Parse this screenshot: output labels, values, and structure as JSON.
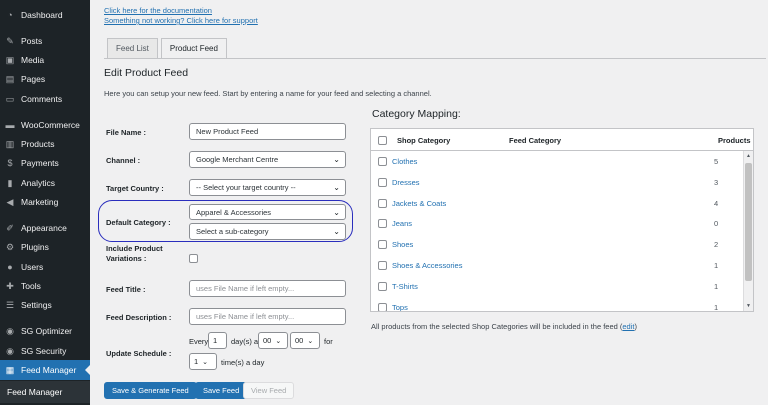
{
  "sidebar": {
    "items": [
      {
        "label": "Dashboard",
        "icon": "dashboard-icon",
        "glyph": "◔"
      },
      {
        "label": "Posts",
        "icon": "pin-icon",
        "glyph": "✎"
      },
      {
        "label": "Media",
        "icon": "media-icon",
        "glyph": "▣"
      },
      {
        "label": "Pages",
        "icon": "pages-icon",
        "glyph": "▤"
      },
      {
        "label": "Comments",
        "icon": "comments-icon",
        "glyph": "▭"
      },
      {
        "label": "WooCommerce",
        "icon": "woocommerce-icon",
        "glyph": "▬"
      },
      {
        "label": "Products",
        "icon": "products-icon",
        "glyph": "▥"
      },
      {
        "label": "Payments",
        "icon": "payments-icon",
        "glyph": "$"
      },
      {
        "label": "Analytics",
        "icon": "analytics-icon",
        "glyph": "▮"
      },
      {
        "label": "Marketing",
        "icon": "megaphone-icon",
        "glyph": "◀"
      },
      {
        "label": "Appearance",
        "icon": "brush-icon",
        "glyph": "✐"
      },
      {
        "label": "Plugins",
        "icon": "plugin-icon",
        "glyph": "⚙"
      },
      {
        "label": "Users",
        "icon": "user-icon",
        "glyph": "●"
      },
      {
        "label": "Tools",
        "icon": "wrench-icon",
        "glyph": "✚"
      },
      {
        "label": "Settings",
        "icon": "settings-icon",
        "glyph": "☰"
      },
      {
        "label": "SG Optimizer",
        "icon": "sg-optimizer-icon",
        "glyph": "◉"
      },
      {
        "label": "SG Security",
        "icon": "sg-security-icon",
        "glyph": "◉"
      },
      {
        "label": "Feed Manager",
        "icon": "feed-manager-icon",
        "glyph": "▦"
      }
    ],
    "submenu_label": "Feed Manager"
  },
  "links": {
    "docs": "Click here for the documentation",
    "support": "Something not working? Click here for support"
  },
  "tabs": [
    "Feed List",
    "Product Feed"
  ],
  "page_title": "Edit Product Feed",
  "intro": "Here you can setup your new feed. Start by entering a name for your feed and selecting a channel.",
  "form": {
    "file_name_label": "File Name :",
    "file_name_value": "New Product Feed",
    "channel_label": "Channel :",
    "channel_value": "Google Merchant Centre",
    "target_country_label": "Target Country :",
    "target_country_value": "-- Select your target country --",
    "default_category_label": "Default Category :",
    "default_category_value": "Apparel & Accessories",
    "sub_category_value": "Select a sub-category",
    "include_variations_label": "Include Product Variations :",
    "feed_title_label": "Feed Title :",
    "feed_title_placeholder": "uses File Name if left empty...",
    "feed_description_label": "Feed Description :",
    "feed_description_placeholder": "uses File Name if left empty...",
    "update_schedule_label": "Update Schedule :",
    "schedule_every": "Every",
    "schedule_days_value": "1",
    "schedule_days_suffix": "day(s) at",
    "schedule_hour": "00",
    "schedule_minute": "00",
    "schedule_for": "for",
    "schedule_times_value": "1",
    "schedule_times_suffix": "time(s) a day"
  },
  "buttons": {
    "save_generate": "Save & Generate Feed",
    "save": "Save Feed",
    "view": "View Feed"
  },
  "category_mapping": {
    "title": "Category Mapping:",
    "headers": [
      "Shop Category",
      "Feed Category",
      "Products"
    ],
    "rows": [
      {
        "name": "Clothes",
        "count": "5"
      },
      {
        "name": "Dresses",
        "count": "3"
      },
      {
        "name": "Jackets & Coats",
        "count": "4"
      },
      {
        "name": "Jeans",
        "count": "0"
      },
      {
        "name": "Shoes",
        "count": "2"
      },
      {
        "name": "Shoes & Accessories",
        "count": "1"
      },
      {
        "name": "T-Shirts",
        "count": "1"
      },
      {
        "name": "Tops",
        "count": "1"
      }
    ],
    "note": "All products from the selected Shop Categories will be included in the feed (",
    "note_link": "edit",
    "note_end": ")"
  },
  "colors": {
    "sidebar_bg": "#1d2327",
    "active": "#2271b1",
    "highlight": "#2a2ebd"
  }
}
